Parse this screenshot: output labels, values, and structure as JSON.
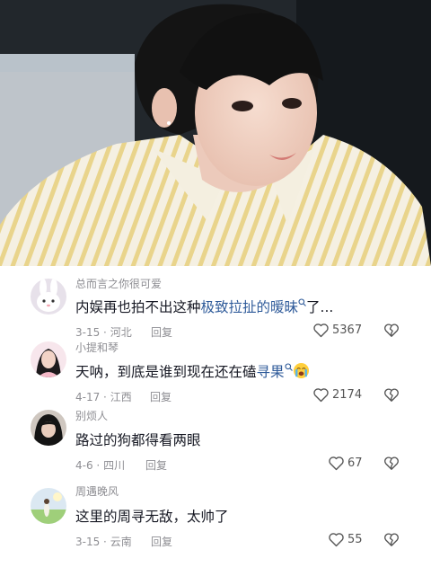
{
  "comments": [
    {
      "username": "总而言之你很可爱",
      "text_pre": "内娱再也拍不出这种",
      "text_link": "极致拉扯的暧昧",
      "text_post": "了...",
      "date": "3-15",
      "location": "河北",
      "reply_label": "回复",
      "likes": "5367",
      "avatar": "rabbit-avatar"
    },
    {
      "username": "小提和琴",
      "text_pre": "天呐，到底是谁到现在还在磕",
      "text_link": "寻果",
      "text_post": "",
      "emoji": "crying-face-emoji",
      "date": "4-17",
      "location": "江西",
      "reply_label": "回复",
      "likes": "2174",
      "avatar": "girl-avatar"
    },
    {
      "username": "别烦人",
      "text_pre": "路过的狗都得看两眼",
      "text_link": "",
      "text_post": "",
      "date": "4-6",
      "location": "四川",
      "reply_label": "回复",
      "likes": "67",
      "avatar": "dark-hair-avatar"
    },
    {
      "username": "周遇晚风",
      "text_pre": "这里的周寻无敌，太帅了",
      "text_link": "",
      "text_post": "",
      "date": "3-15",
      "location": "云南",
      "reply_label": "回复",
      "likes": "55",
      "avatar": "meadow-avatar"
    }
  ],
  "colors": {
    "link": "#2f5b9a",
    "secondary_text": "#8e8e93",
    "primary_text": "#161823"
  }
}
